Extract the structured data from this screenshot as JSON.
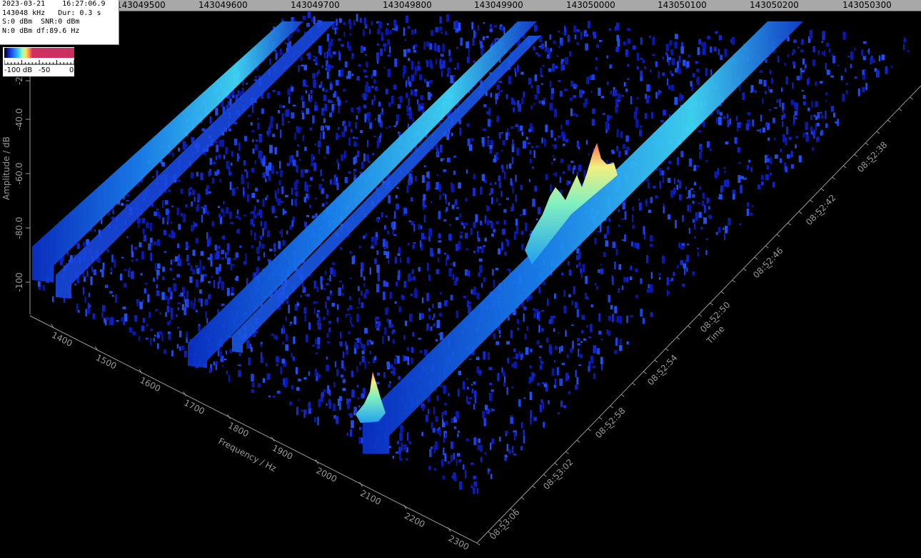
{
  "ruler": {
    "ticks": [
      "143049500",
      "143049600",
      "143049700",
      "143049800",
      "143049900",
      "143050000",
      "143050100",
      "143050200",
      "143050300"
    ]
  },
  "info": {
    "line1": "2023-03-21    16:27:06.9",
    "line2": "143048 kHz   Dur: 0.3 s",
    "line3": "S:0 dBm  SNR:0 dBm",
    "line4": "N:0 dBm df:89.6 Hz"
  },
  "legend": {
    "min": "-100 dB",
    "mid": "-50",
    "max": "0"
  },
  "amplitude_axis": {
    "title": "Amplitude / dB",
    "ticks": [
      "-2",
      "-40.0",
      "-60.0",
      "-80.0",
      "-100"
    ]
  },
  "frequency_axis": {
    "title": "Frequency / Hz",
    "ticks": [
      "1400",
      "1500",
      "1600",
      "1700",
      "1800",
      "1900",
      "2000",
      "2100",
      "2200",
      "2300"
    ]
  },
  "time_axis": {
    "title": "Time",
    "ticks": [
      "08:52:38",
      "08:52:42",
      "08:52:46",
      "08:52:50",
      "08:52:54",
      "08:52:58",
      "08:53:02",
      "08:53:06"
    ]
  },
  "colors": {
    "background": "#000000",
    "ruler": "#a8a8a8",
    "noise": "#1a2bd8",
    "signal": "#2aa8f0",
    "peak": "#e06040",
    "axis": "#9a9a9a"
  }
}
